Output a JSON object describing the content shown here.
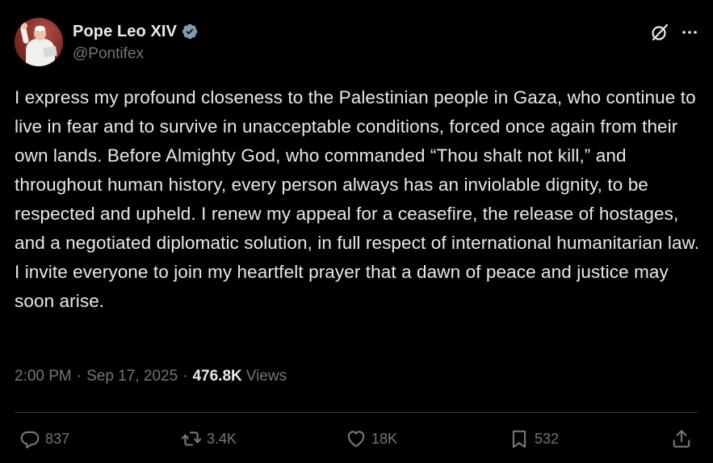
{
  "author": {
    "display_name": "Pope Leo XIV",
    "handle": "@Pontifex",
    "verified": true,
    "verified_color": "#829aab"
  },
  "header_icons": [
    "grok-icon",
    "more-icon"
  ],
  "tweet": {
    "text": "I express my profound closeness to the Palestinian people in Gaza, who continue to live in fear and to survive in unacceptable conditions, forced once again from their own lands. Before Almighty God, who commanded “Thou shalt not kill,” and throughout human history, every person always has an inviolable dignity, to be respected and upheld. I renew my appeal for a ceasefire, the release of hostages, and a negotiated diplomatic solution, in full respect of international humanitarian law. I invite everyone to join my heartfelt prayer that a dawn of peace and justice may soon arise."
  },
  "meta": {
    "time": "2:00 PM",
    "separator": "·",
    "date": "Sep 17, 2025",
    "views_count": "476.8K",
    "views_label": "Views"
  },
  "actions": {
    "replies": "837",
    "reposts": "3.4K",
    "likes": "18K",
    "bookmarks": "532"
  },
  "colors": {
    "background": "#000000",
    "text_primary": "#e7e9ea",
    "text_secondary": "#71767b",
    "divider": "#2f3336"
  }
}
